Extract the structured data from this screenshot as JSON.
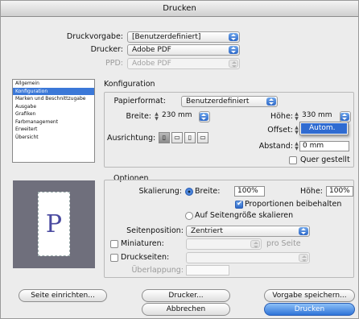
{
  "window": {
    "title": "Drucken"
  },
  "top": {
    "preset_label": "Druckvorgabe:",
    "preset_value": "[Benutzerdefiniert]",
    "printer_label": "Drucker:",
    "printer_value": "Adobe PDF",
    "ppd_label": "PPD:",
    "ppd_value": "Adobe PDF"
  },
  "sidebar": {
    "items": [
      {
        "label": "Allgemein"
      },
      {
        "label": "Konfiguration"
      },
      {
        "label": "Marken und Beschnittzugabe"
      },
      {
        "label": "Ausgabe"
      },
      {
        "label": "Grafiken"
      },
      {
        "label": "Farbmanagement"
      },
      {
        "label": "Erweitert"
      },
      {
        "label": "Übersicht"
      }
    ],
    "selected_index": 1
  },
  "config": {
    "heading": "Konfiguration",
    "paper_label": "Papierformat:",
    "paper_value": "Benutzerdefiniert",
    "width_label": "Breite:",
    "width_value": "230 mm",
    "height_label": "Höhe:",
    "height_value": "330 mm",
    "offset_label": "Offset:",
    "orientation_label": "Ausrichtung:",
    "spacing_label": "Abstand:",
    "spacing_value": "0 mm",
    "landscape_label": "Quer gestellt",
    "landscape_checked": false,
    "dropdown_option": "Autom."
  },
  "options": {
    "heading": "Optionen",
    "scaling_label": "Skalierung:",
    "width_radio_label": "Breite:",
    "width_scale": "100%",
    "height_scale_label": "Höhe:",
    "height_scale": "100%",
    "keep_proportions_label": "Proportionen beibehalten",
    "keep_proportions_checked": true,
    "fit_page_label": "Auf Seitengröße skalieren",
    "page_position_label": "Seitenposition:",
    "page_position_value": "Zentriert",
    "thumbnails_label": "Miniaturen:",
    "per_page_label": "pro Seite",
    "tiling_label": "Druckseiten:",
    "overlap_label": "Überlappung:"
  },
  "preview": {
    "letter": "P"
  },
  "buttons": {
    "page_setup": "Seite einrichten...",
    "printer": "Drucker...",
    "save_preset": "Vorgabe speichern...",
    "cancel": "Abbrechen",
    "print": "Drucken"
  },
  "icons": {
    "popup_arrows": "updown-arrows-icon",
    "stepper": "stepper-arrows-icon",
    "orientations": [
      "portrait-icon",
      "landscape-icon",
      "reverse-portrait-icon",
      "reverse-landscape-icon"
    ]
  }
}
